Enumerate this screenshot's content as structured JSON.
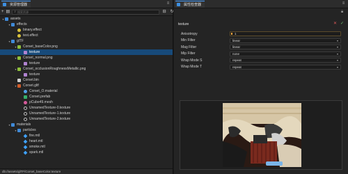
{
  "asset_panel": {
    "tab_title": "资源管理器",
    "search_placeholder": "搜索资源",
    "status_path": "db://assets/glTF/Corset_baseColor.texture",
    "tree": [
      {
        "label": "assets",
        "depth": 0,
        "icon": "folder-icon",
        "open": true
      },
      {
        "label": "effects",
        "depth": 1,
        "icon": "folder-icon",
        "open": true
      },
      {
        "label": "binary.effect",
        "depth": 2,
        "icon": "effect-icon"
      },
      {
        "label": "test.effect",
        "depth": 2,
        "icon": "effect-icon"
      },
      {
        "label": "glTF",
        "depth": 1,
        "icon": "folder-icon",
        "open": true
      },
      {
        "label": "Corset_baseColor.png",
        "depth": 2,
        "icon": "image-icon",
        "open": true
      },
      {
        "label": "texture",
        "depth": 3,
        "icon": "texture-icon",
        "selected": true
      },
      {
        "label": "Corset_normal.png",
        "depth": 2,
        "icon": "image-icon",
        "open": true
      },
      {
        "label": "texture",
        "depth": 3,
        "icon": "texture-icon"
      },
      {
        "label": "Corset_occlusionRoughnessMetallic.png",
        "depth": 2,
        "icon": "image-icon",
        "open": true
      },
      {
        "label": "texture",
        "depth": 3,
        "icon": "texture-icon"
      },
      {
        "label": "Corset.bin",
        "depth": 2,
        "icon": "bin-icon"
      },
      {
        "label": "Corset.gltf",
        "depth": 2,
        "icon": "gltf-icon",
        "open": true
      },
      {
        "label": "Corset_O.material",
        "depth": 3,
        "icon": "material-icon"
      },
      {
        "label": "Corset.prefab",
        "depth": 3,
        "icon": "prefab-icon"
      },
      {
        "label": "pCube49.mesh",
        "depth": 3,
        "icon": "mesh-icon"
      },
      {
        "label": "UnnamedTexture-0.texture",
        "depth": 3,
        "icon": "texture-ref-icon"
      },
      {
        "label": "UnnamedTexture-1.texture",
        "depth": 3,
        "icon": "texture-ref-icon"
      },
      {
        "label": "UnnamedTexture-2.texture",
        "depth": 3,
        "icon": "texture-ref-icon"
      },
      {
        "label": "materials",
        "depth": 1,
        "icon": "folder-icon",
        "open": true
      },
      {
        "label": "particles",
        "depth": 2,
        "icon": "folder-icon",
        "open": true
      },
      {
        "label": "fire.mtl",
        "depth": 3,
        "icon": "sky-icon"
      },
      {
        "label": "heart.mtl",
        "depth": 3,
        "icon": "sky-icon"
      },
      {
        "label": "smoke.mtl",
        "depth": 3,
        "icon": "sky-icon"
      },
      {
        "label": "spark.mtl",
        "depth": 3,
        "icon": "sky-icon"
      }
    ]
  },
  "inspector": {
    "tab_title": "属性检查器",
    "header_title": "texture",
    "properties": [
      {
        "label": "Anisotropy",
        "value": "1",
        "kind": "number"
      },
      {
        "label": "Min Filter",
        "value": "linear",
        "kind": "select"
      },
      {
        "label": "Mag Filter",
        "value": "linear",
        "kind": "select"
      },
      {
        "label": "Mip Filter",
        "value": "none",
        "kind": "select"
      },
      {
        "label": "Wrap Mode S",
        "value": "repeat",
        "kind": "select"
      },
      {
        "label": "Wrap Mode T",
        "value": "repeat",
        "kind": "select"
      }
    ]
  },
  "colors": {
    "selection": "#174a7a",
    "accent": "#4aa0ff",
    "panel": "#242424"
  }
}
